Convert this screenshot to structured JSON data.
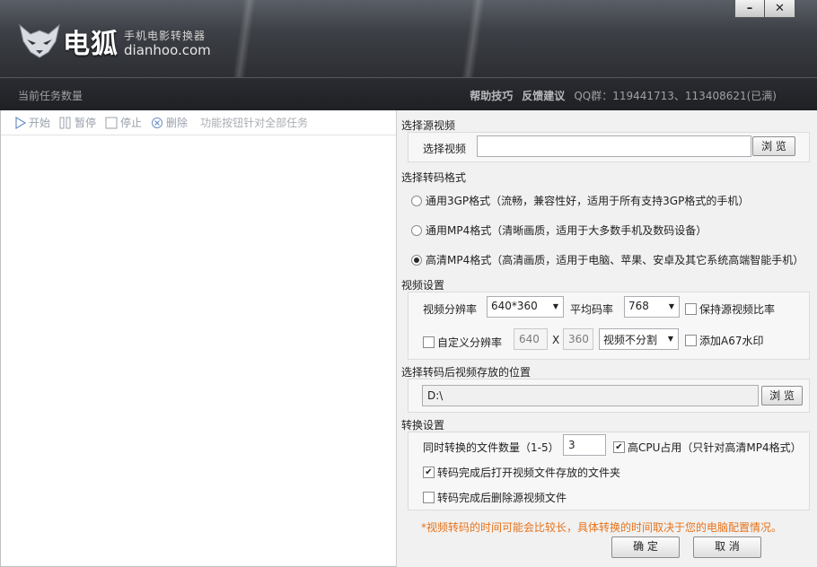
{
  "app": {
    "logo_text": "电狐",
    "subtitle": "手机电影转换器",
    "domain": "dianhoo.com",
    "minimize": "–",
    "close": "✕"
  },
  "subbar": {
    "task_count_label": "当前任务数量",
    "help": "帮助技巧",
    "feedback": "反馈建议",
    "qq": "QQ群：119441713、113408621(已满)"
  },
  "toolbar": {
    "start": "开始",
    "pause": "暂停",
    "stop": "停止",
    "delete": "删除",
    "note": "功能按钮针对全部任务"
  },
  "source": {
    "group_title": "选择源视频",
    "label": "选择视频",
    "value": "",
    "browse": "浏 览"
  },
  "format": {
    "group_title": "选择转码格式",
    "options": [
      {
        "label": "通用3GP格式（流畅，兼容性好，适用于所有支持3GP格式的手机）",
        "selected": false
      },
      {
        "label": "通用MP4格式（清晰画质，适用于大多数手机及数码设备）",
        "selected": false
      },
      {
        "label": "高清MP4格式（高清画质，适用于电脑、苹果、安卓及其它系统高端智能手机）",
        "selected": true
      }
    ]
  },
  "video": {
    "group_title": "视频设置",
    "resolution_label": "视频分辨率",
    "resolution_value": "640*360",
    "bitrate_label": "平均码率",
    "bitrate_value": "768",
    "keep_ratio": "保持源视频比率",
    "keep_ratio_checked": false,
    "custom_res": "自定义分辨率",
    "custom_res_checked": false,
    "width": "640",
    "x": "X",
    "height": "360",
    "split_value": "视频不分割",
    "watermark": "添加A67水印",
    "watermark_checked": false
  },
  "output": {
    "group_title": "选择转码后视频存放的位置",
    "path": "D:\\",
    "browse": "浏 览"
  },
  "convert": {
    "group_title": "转换设置",
    "concurrent_label": "同时转换的文件数量（1-5）",
    "concurrent_value": "3",
    "high_cpu": "高CPU占用（只针对高清MP4格式）",
    "high_cpu_checked": true,
    "open_folder": "转码完成后打开视频文件存放的文件夹",
    "open_folder_checked": true,
    "delete_source": "转码完成后删除源视频文件",
    "delete_source_checked": false
  },
  "note": "*视频转码的时间可能会比较长，具体转换的时间取决于您的电脑配置情况。",
  "buttons": {
    "ok": "确  定",
    "cancel": "取  消"
  },
  "colors": {
    "note": "#e8731a",
    "header_dark": "#2c2e33"
  }
}
